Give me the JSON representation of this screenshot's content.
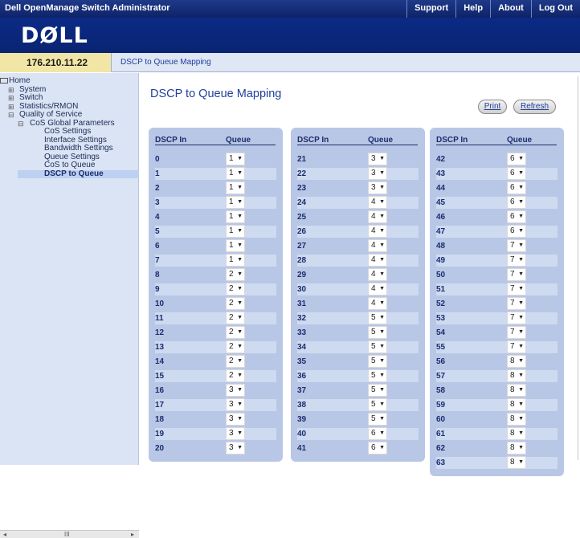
{
  "app": {
    "title": "Dell OpenManage Switch Administrator",
    "links": [
      "Support",
      "Help",
      "About",
      "Log Out"
    ],
    "brand": "DØLL"
  },
  "ipbar": {
    "ip": "176.210.11.22",
    "crumb": "DSCP to Queue Mapping"
  },
  "sidebar": {
    "items": [
      {
        "label": "Home",
        "indent": 0,
        "exp": "",
        "selected": false
      },
      {
        "label": "System",
        "indent": 1,
        "exp": "⊞",
        "selected": false
      },
      {
        "label": "Switch",
        "indent": 1,
        "exp": "⊞",
        "selected": false
      },
      {
        "label": "Statistics/RMON",
        "indent": 1,
        "exp": "⊞",
        "selected": false
      },
      {
        "label": "Quality of Service",
        "indent": 1,
        "exp": "⊟",
        "selected": false
      },
      {
        "label": "CoS Global Parameters",
        "indent": 2,
        "exp": "⊟",
        "selected": false
      },
      {
        "label": "CoS Settings",
        "indent": 3,
        "exp": "",
        "selected": false
      },
      {
        "label": "Interface Settings",
        "indent": 3,
        "exp": "",
        "selected": false
      },
      {
        "label": "Bandwidth Settings",
        "indent": 3,
        "exp": "",
        "selected": false
      },
      {
        "label": "Queue Settings",
        "indent": 3,
        "exp": "",
        "selected": false
      },
      {
        "label": "CoS to Queue",
        "indent": 3,
        "exp": "",
        "selected": false
      },
      {
        "label": "DSCP to Queue",
        "indent": 3,
        "exp": "",
        "selected": true
      }
    ],
    "scroll_mid": "III"
  },
  "main": {
    "title": "DSCP to Queue Mapping",
    "print_label": "Print",
    "refresh_label": "Refresh",
    "col_dscp": "DSCP In",
    "col_queue": "Queue"
  },
  "mapping": [
    [
      {
        "dscp": "0",
        "queue": "1"
      },
      {
        "dscp": "1",
        "queue": "1"
      },
      {
        "dscp": "2",
        "queue": "1"
      },
      {
        "dscp": "3",
        "queue": "1"
      },
      {
        "dscp": "4",
        "queue": "1"
      },
      {
        "dscp": "5",
        "queue": "1"
      },
      {
        "dscp": "6",
        "queue": "1"
      },
      {
        "dscp": "7",
        "queue": "1"
      },
      {
        "dscp": "8",
        "queue": "2"
      },
      {
        "dscp": "9",
        "queue": "2"
      },
      {
        "dscp": "10",
        "queue": "2"
      },
      {
        "dscp": "11",
        "queue": "2"
      },
      {
        "dscp": "12",
        "queue": "2"
      },
      {
        "dscp": "13",
        "queue": "2"
      },
      {
        "dscp": "14",
        "queue": "2"
      },
      {
        "dscp": "15",
        "queue": "2"
      },
      {
        "dscp": "16",
        "queue": "3"
      },
      {
        "dscp": "17",
        "queue": "3"
      },
      {
        "dscp": "18",
        "queue": "3"
      },
      {
        "dscp": "19",
        "queue": "3"
      },
      {
        "dscp": "20",
        "queue": "3"
      }
    ],
    [
      {
        "dscp": "21",
        "queue": "3"
      },
      {
        "dscp": "22",
        "queue": "3"
      },
      {
        "dscp": "23",
        "queue": "3"
      },
      {
        "dscp": "24",
        "queue": "4"
      },
      {
        "dscp": "25",
        "queue": "4"
      },
      {
        "dscp": "26",
        "queue": "4"
      },
      {
        "dscp": "27",
        "queue": "4"
      },
      {
        "dscp": "28",
        "queue": "4"
      },
      {
        "dscp": "29",
        "queue": "4"
      },
      {
        "dscp": "30",
        "queue": "4"
      },
      {
        "dscp": "31",
        "queue": "4"
      },
      {
        "dscp": "32",
        "queue": "5"
      },
      {
        "dscp": "33",
        "queue": "5"
      },
      {
        "dscp": "34",
        "queue": "5"
      },
      {
        "dscp": "35",
        "queue": "5"
      },
      {
        "dscp": "36",
        "queue": "5"
      },
      {
        "dscp": "37",
        "queue": "5"
      },
      {
        "dscp": "38",
        "queue": "5"
      },
      {
        "dscp": "39",
        "queue": "5"
      },
      {
        "dscp": "40",
        "queue": "6"
      },
      {
        "dscp": "41",
        "queue": "6"
      }
    ],
    [
      {
        "dscp": "42",
        "queue": "6"
      },
      {
        "dscp": "43",
        "queue": "6"
      },
      {
        "dscp": "44",
        "queue": "6"
      },
      {
        "dscp": "45",
        "queue": "6"
      },
      {
        "dscp": "46",
        "queue": "6"
      },
      {
        "dscp": "47",
        "queue": "6"
      },
      {
        "dscp": "48",
        "queue": "7"
      },
      {
        "dscp": "49",
        "queue": "7"
      },
      {
        "dscp": "50",
        "queue": "7"
      },
      {
        "dscp": "51",
        "queue": "7"
      },
      {
        "dscp": "52",
        "queue": "7"
      },
      {
        "dscp": "53",
        "queue": "7"
      },
      {
        "dscp": "54",
        "queue": "7"
      },
      {
        "dscp": "55",
        "queue": "7"
      },
      {
        "dscp": "56",
        "queue": "8"
      },
      {
        "dscp": "57",
        "queue": "8"
      },
      {
        "dscp": "58",
        "queue": "8"
      },
      {
        "dscp": "59",
        "queue": "8"
      },
      {
        "dscp": "60",
        "queue": "8"
      },
      {
        "dscp": "61",
        "queue": "8"
      },
      {
        "dscp": "62",
        "queue": "8"
      },
      {
        "dscp": "63",
        "queue": "8"
      }
    ]
  ]
}
